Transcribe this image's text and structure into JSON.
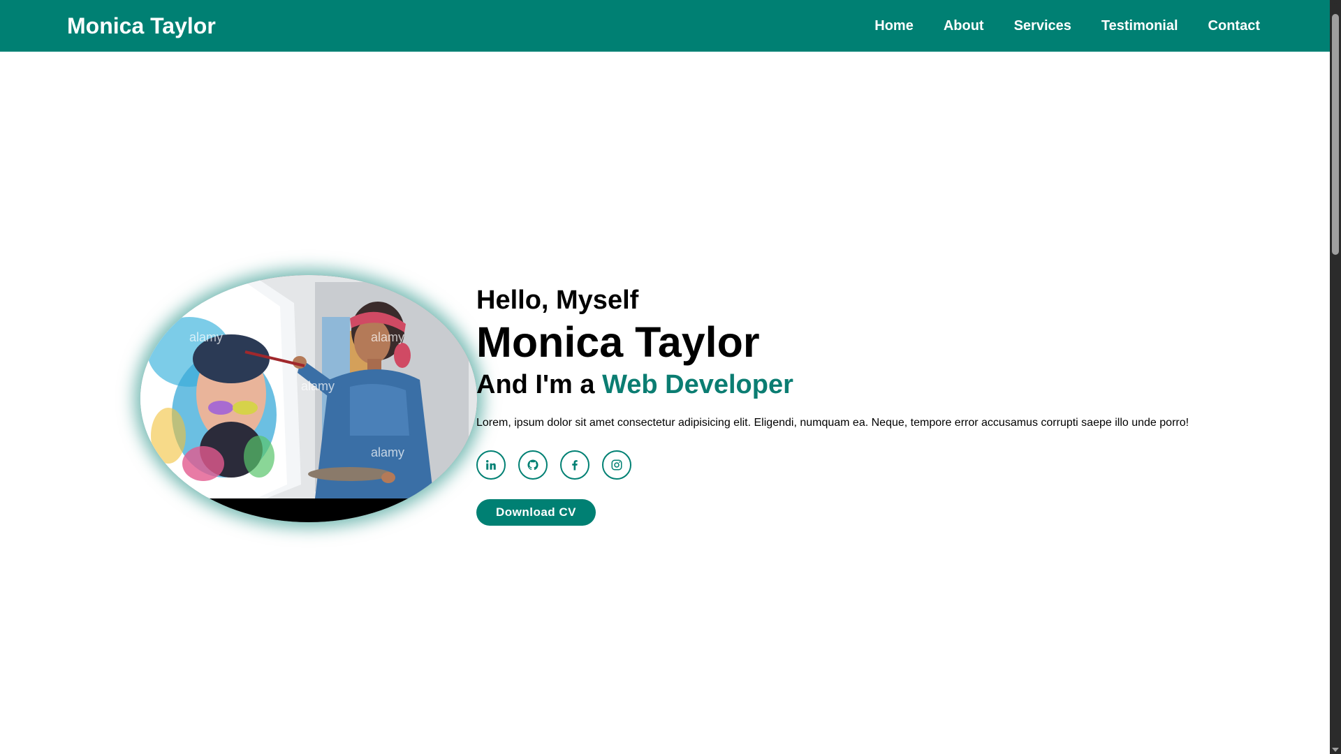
{
  "nav": {
    "brand": "Monica Taylor",
    "links": [
      "Home",
      "About",
      "Services",
      "Testimonial",
      "Contact"
    ]
  },
  "hero": {
    "greeting": "Hello, Myself",
    "name": "Monica Taylor",
    "role_prefix": "And I'm a ",
    "role": "Web Developer",
    "description": "Lorem, ipsum dolor sit amet consectetur adipisicing elit. Eligendi, numquam ea. Neque, tempore error accusamus corrupti saepe illo unde porro!",
    "social_icons": [
      "linkedin-icon",
      "github-icon",
      "facebook-icon",
      "instagram-icon"
    ],
    "cv_button": "Download CV",
    "image_watermark": "alamy"
  },
  "colors": {
    "primary": "#008073",
    "highlight": "#0b7d72",
    "text": "#000000",
    "background": "#ffffff"
  }
}
